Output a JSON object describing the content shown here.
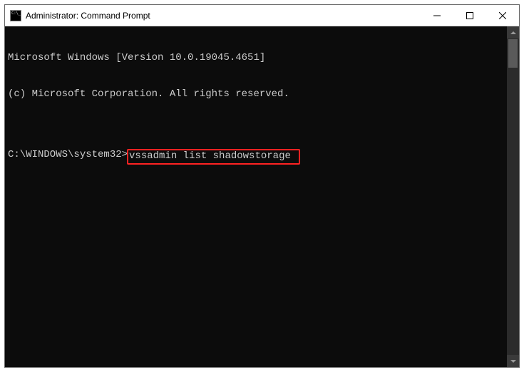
{
  "titlebar": {
    "title": "Administrator: Command Prompt"
  },
  "terminal": {
    "line1": "Microsoft Windows [Version 10.0.19045.4651]",
    "line2": "(c) Microsoft Corporation. All rights reserved.",
    "blank": "",
    "prompt": "C:\\WINDOWS\\system32>",
    "command": "vssadmin list shadowstorage"
  }
}
